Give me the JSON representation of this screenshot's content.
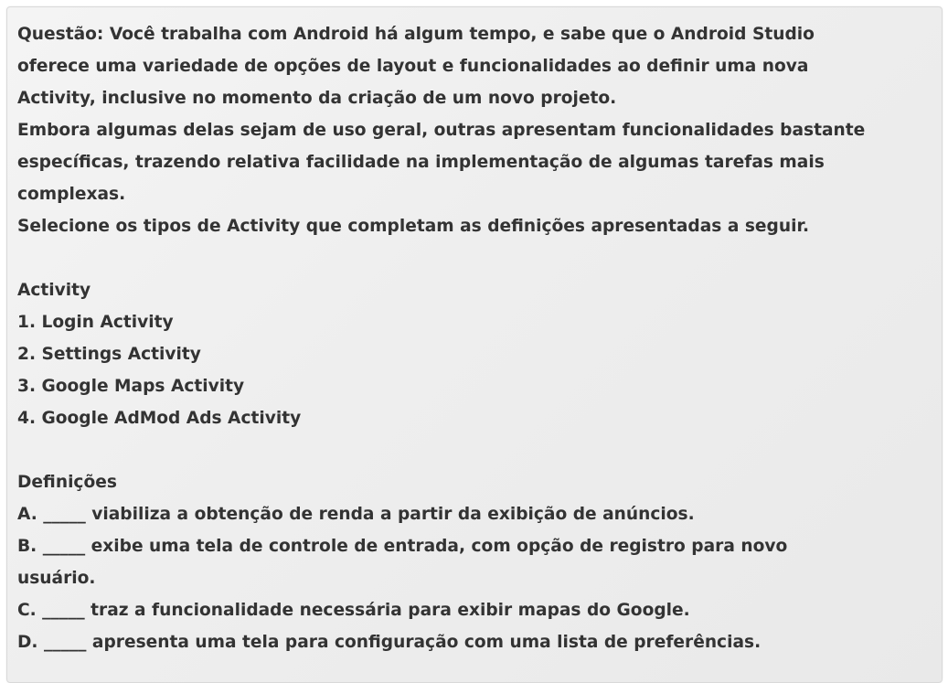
{
  "question": {
    "intro_lines": [
      "Questão: Você trabalha com Android há algum tempo, e sabe que o Android Studio",
      "oferece uma variedade de opções de layout e funcionalidades ao definir uma nova",
      "Activity, inclusive no momento da criação de um novo projeto.",
      "Embora algumas delas sejam de uso geral, outras apresentam funcionalidades bastante",
      "específicas, trazendo relativa facilidade na implementação de algumas tarefas mais",
      "complexas.",
      "Selecione os tipos de Activity que completam as definições apresentadas a seguir."
    ],
    "activity_heading": "Activity",
    "activities": [
      "1. Login Activity",
      "2. Settings Activity",
      "3. Google Maps Activity",
      "4. Google AdMod Ads Activity"
    ],
    "definitions_heading": "Definições",
    "definitions": [
      "A. _____ viabiliza a obtenção de renda a partir da exibição de anúncios.",
      "B. _____ exibe uma tela de controle de entrada, com opção de registro para novo",
      "usuário.",
      "C. _____ traz a funcionalidade necessária para exibir mapas do Google.",
      "D. _____ apresenta uma tela para configuração com uma lista de preferências."
    ]
  }
}
